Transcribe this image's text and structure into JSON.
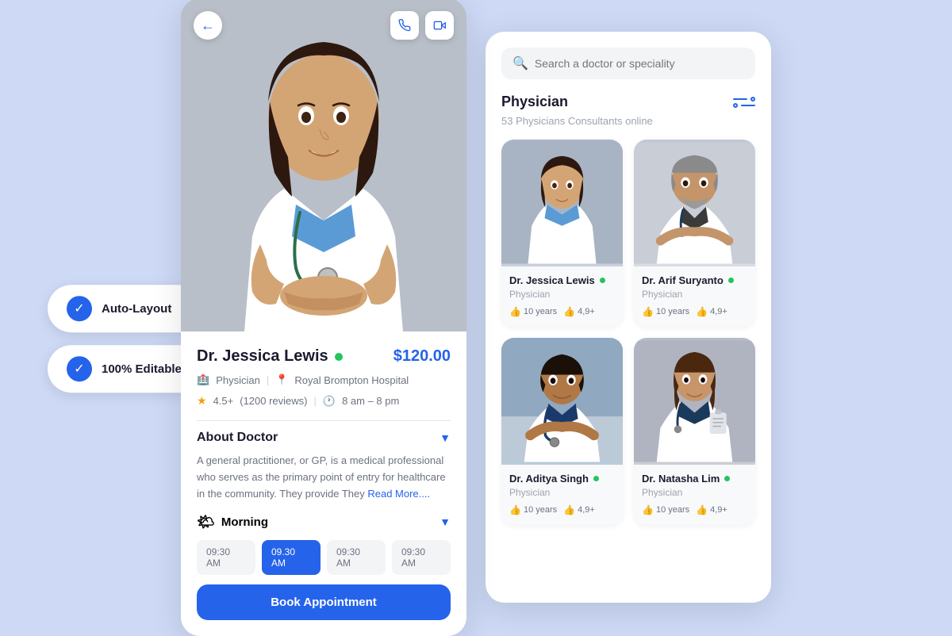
{
  "badges": [
    {
      "id": "auto-layout",
      "label": "Auto-Layout"
    },
    {
      "id": "editable",
      "label": "100% Editable"
    }
  ],
  "profile": {
    "back_button": "←",
    "phone_icon": "📞",
    "video_icon": "🖥",
    "doctor_name": "Dr. Jessica Lewis",
    "online_status": "online",
    "price": "$120.00",
    "specialty": "Physician",
    "hospital": "Royal Brompton Hospital",
    "rating": "4.5+",
    "reviews": "(1200 reviews)",
    "hours": "8 am – 8 pm",
    "about_title": "About Doctor",
    "about_text": "A general practitioner, or GP, is a medical professional who serves as the primary point of entry for healthcare in the community. They provide They",
    "read_more": "Read More....",
    "morning_label": "Morning",
    "time_slots": [
      {
        "time": "09:30 AM",
        "active": false
      },
      {
        "time": "09.30 AM",
        "active": true
      },
      {
        "time": "09:30 AM",
        "active": false
      },
      {
        "time": "09:30 AM",
        "active": false
      }
    ],
    "book_button": "Book Appointment"
  },
  "search": {
    "placeholder": "Search a doctor or speciality"
  },
  "physician_section": {
    "heading": "Physician",
    "count": "53 Physicians Consultants online"
  },
  "doctors": [
    {
      "id": "jessica-lewis",
      "name": "Dr. Jessica Lewis",
      "specialty": "Physician",
      "experience": "10 years",
      "rating": "4,9+",
      "online": true,
      "bg": "bg-gray-blue"
    },
    {
      "id": "arif-suryanto",
      "name": "Dr. Arif Suryanto",
      "specialty": "Physician",
      "experience": "10 years",
      "rating": "4,9+",
      "online": true,
      "bg": "bg-light-gray"
    },
    {
      "id": "aditya-singh",
      "name": "Dr. Aditya Singh",
      "specialty": "Physician",
      "experience": "10 years",
      "rating": "4,9+",
      "online": true,
      "bg": "bg-blue-teal"
    },
    {
      "id": "natasha-lim",
      "name": "Dr. Natasha Lim",
      "specialty": "Physician",
      "experience": "10 years",
      "rating": "4,9+",
      "online": true,
      "bg": "bg-warm-gray"
    }
  ]
}
